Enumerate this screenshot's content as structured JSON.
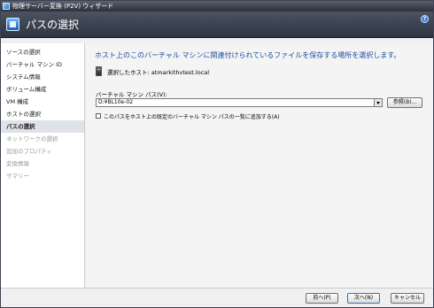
{
  "window": {
    "title": "物理サーバー変換 (P2V) ウィザード"
  },
  "header": {
    "title": "パスの選択",
    "help_icon": "help-icon"
  },
  "sidebar": {
    "items": [
      {
        "label": "ソースの選択",
        "state": "normal"
      },
      {
        "label": "バーチャル マシン ID",
        "state": "normal"
      },
      {
        "label": "システム情報",
        "state": "normal"
      },
      {
        "label": "ボリューム構成",
        "state": "normal"
      },
      {
        "label": "VM 構成",
        "state": "normal"
      },
      {
        "label": "ホストの選択",
        "state": "normal"
      },
      {
        "label": "パスの選択",
        "state": "selected"
      },
      {
        "label": "ネットワークの選択",
        "state": "disabled"
      },
      {
        "label": "追加のプロパティ",
        "state": "disabled"
      },
      {
        "label": "変換情報",
        "state": "disabled"
      },
      {
        "label": "サマリー",
        "state": "disabled"
      }
    ]
  },
  "main": {
    "heading": "ホスト上のこのバーチャル マシンに関連付けられているファイルを保存する場所を選択します。",
    "selected_host": "選択したホスト: atmarkithvtest.local",
    "path_label": "バーチャル マシン パス(V):",
    "path_value": "D:¥BL10e-02",
    "browse_label": "参照(B)...",
    "checkbox_label": "このパスをホスト上の既定のバーチャル マシン パスの一覧に追加する(A)",
    "checkbox_checked": false
  },
  "footer": {
    "prev_label": "前へ(P)",
    "next_label": "次へ(N)",
    "cancel_label": "キャンセル"
  }
}
